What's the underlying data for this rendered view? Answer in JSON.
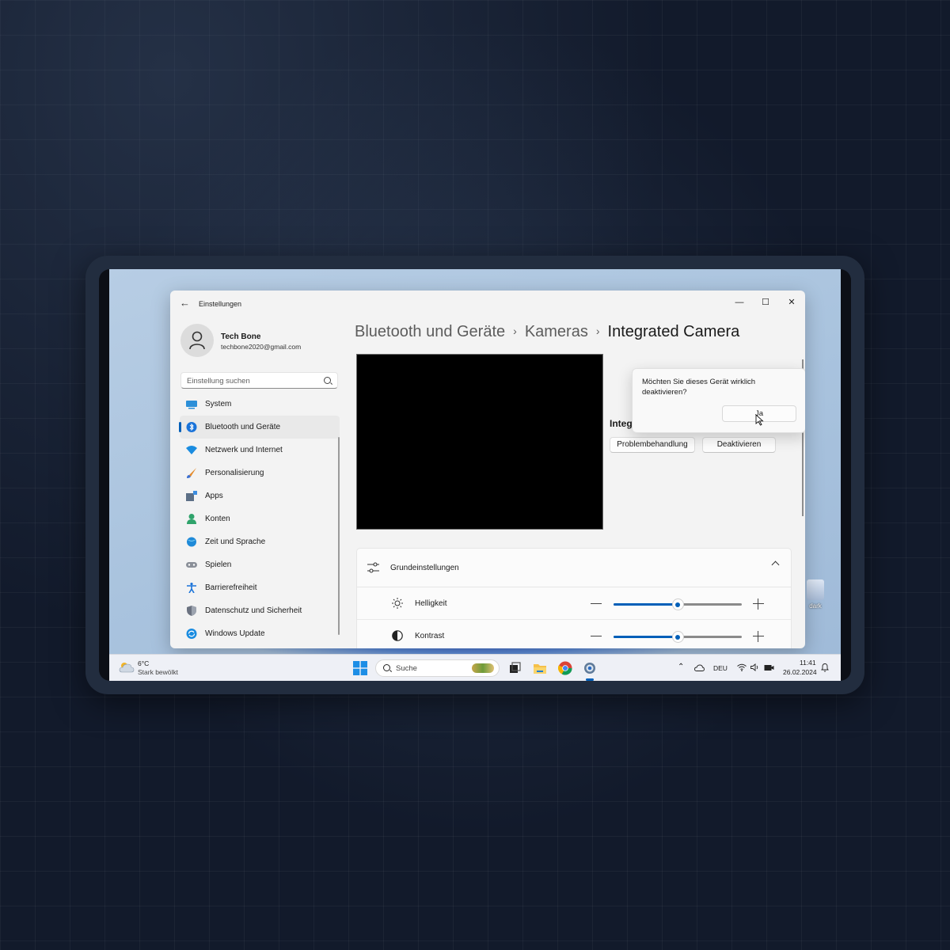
{
  "window": {
    "title": "Einstellungen",
    "back_glyph": "←",
    "minimize_glyph": "—",
    "maximize_glyph": "☐",
    "close_glyph": "✕"
  },
  "profile": {
    "name": "Tech Bone",
    "email": "techbone2020@gmail.com"
  },
  "search": {
    "placeholder": "Einstellung suchen"
  },
  "sidebar": {
    "items": [
      {
        "label": "System",
        "icon": "system-icon",
        "color": "#2c8fd8"
      },
      {
        "label": "Bluetooth und Geräte",
        "icon": "bluetooth-icon",
        "color": "#1a73d9",
        "active": true
      },
      {
        "label": "Netzwerk und Internet",
        "icon": "wifi-icon",
        "color": "#1a8ce0"
      },
      {
        "label": "Personalisierung",
        "icon": "brush-icon",
        "color": "#e48a2b"
      },
      {
        "label": "Apps",
        "icon": "apps-icon",
        "color": "#5c6f86"
      },
      {
        "label": "Konten",
        "icon": "account-icon",
        "color": "#2fa36b"
      },
      {
        "label": "Zeit und Sprache",
        "icon": "globe-clock-icon",
        "color": "#1f8ad8"
      },
      {
        "label": "Spielen",
        "icon": "gamepad-icon",
        "color": "#8a8f98"
      },
      {
        "label": "Barrierefreiheit",
        "icon": "accessibility-icon",
        "color": "#1a73d9"
      },
      {
        "label": "Datenschutz und Sicherheit",
        "icon": "shield-icon",
        "color": "#6b7280"
      },
      {
        "label": "Windows Update",
        "icon": "update-icon",
        "color": "#1a8ce0"
      }
    ]
  },
  "breadcrumb": {
    "level1": "Bluetooth und Geräte",
    "level2": "Kameras",
    "current": "Integrated Camera",
    "separator": "›"
  },
  "device": {
    "name_partial": "Integ",
    "troubleshoot_label": "Problembehandlung",
    "disable_label": "Deaktivieren"
  },
  "confirm_flyout": {
    "message": "Möchten Sie dieses Gerät wirklich deaktivieren?",
    "yes_label": "Ja"
  },
  "basic_settings": {
    "title": "Grundeinstellungen",
    "brightness": {
      "label": "Helligkeit",
      "value": 0.5
    },
    "contrast": {
      "label": "Kontrast",
      "value": 0.5
    }
  },
  "desktop": {
    "icon_label": "dark"
  },
  "taskbar": {
    "weather_temp": "6°C",
    "weather_desc": "Stark bewölkt",
    "search_label": "Suche",
    "language": "DEU",
    "time": "11:41",
    "date": "26.02.2024",
    "accent_color": "#005fb8"
  }
}
